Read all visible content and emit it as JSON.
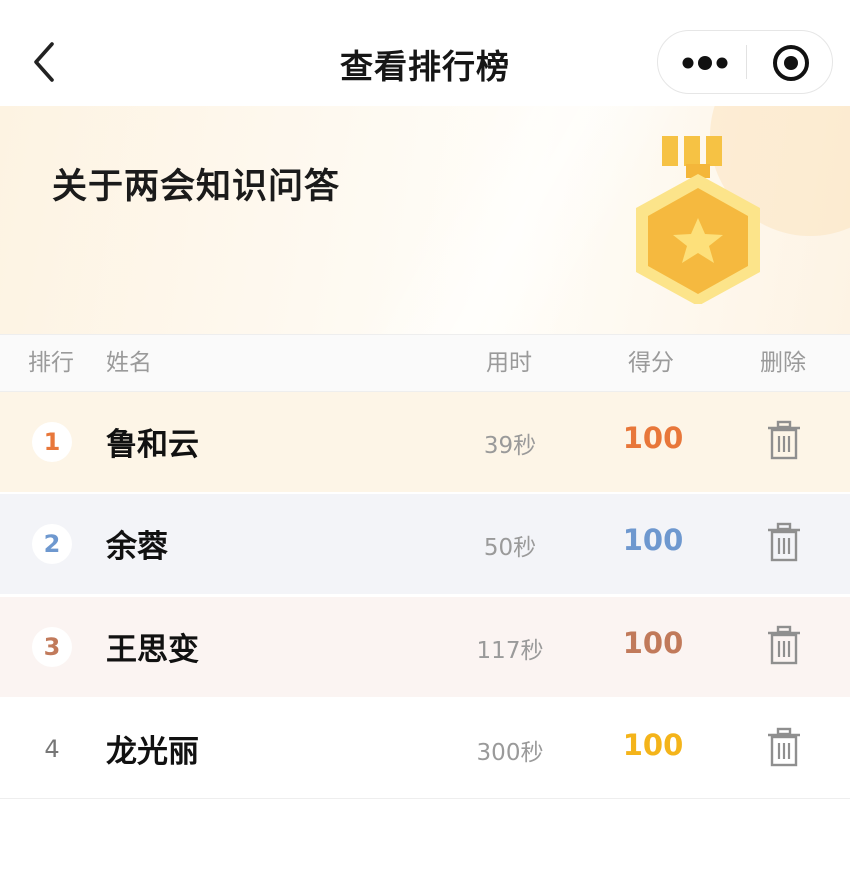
{
  "nav": {
    "title": "查看排行榜",
    "back_icon": "chevron-left-icon",
    "more_icon": "more-dots-icon",
    "close_icon": "target-close-icon"
  },
  "banner": {
    "title": "关于两会知识问答",
    "icon": "medal-star-icon"
  },
  "table": {
    "columns": {
      "rank": "排行",
      "name": "姓名",
      "time": "用时",
      "score": "得分",
      "delete": "删除"
    },
    "rows": [
      {
        "rank": "1",
        "name": "鲁和云",
        "time": "39秒",
        "score": "100"
      },
      {
        "rank": "2",
        "name": "余蓉",
        "time": "50秒",
        "score": "100"
      },
      {
        "rank": "3",
        "name": "王思变",
        "time": "117秒",
        "score": "100"
      },
      {
        "rank": "4",
        "name": "龙光丽",
        "time": "300秒",
        "score": "100"
      }
    ]
  },
  "colors": {
    "rank1": "#e8773a",
    "rank2": "#6e98cf",
    "rank3": "#c17a5b",
    "rank4_score": "#f4b41a",
    "row1_bg": "#fdf5e7",
    "row2_bg": "#f3f4f8",
    "row3_bg": "#fbf4f2",
    "row4_bg": "#ffffff"
  }
}
